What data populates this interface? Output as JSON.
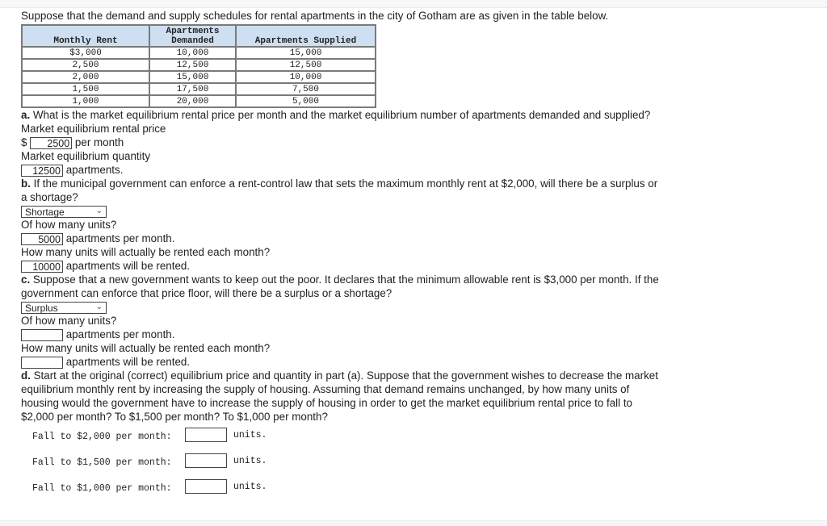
{
  "intro": "Suppose that the demand and supply schedules for rental apartments in the city of Gotham are as given in the table below.",
  "table": {
    "headers": [
      "Monthly Rent",
      "Apartments Demanded",
      "Apartments Supplied"
    ],
    "header_lines": {
      "demanded_1": "Apartments",
      "demanded_2": "Demanded"
    },
    "rows": [
      [
        "$3,000",
        "10,000",
        "15,000"
      ],
      [
        "2,500",
        "12,500",
        "12,500"
      ],
      [
        "2,000",
        "15,000",
        "10,000"
      ],
      [
        "1,500",
        "17,500",
        "7,500"
      ],
      [
        "1,000",
        "20,000",
        "5,000"
      ]
    ]
  },
  "part_a": {
    "label": "a.",
    "question": " What is the market equilibrium rental price per month and the market equilibrium number of apartments demanded and supplied?",
    "price_label": "Market equilibrium rental price",
    "currency": "$",
    "price_value": "2500",
    "price_suffix": "per month",
    "qty_label": "Market equilibrium quantity",
    "qty_value": "12500",
    "qty_suffix": "apartments."
  },
  "part_b": {
    "label": "b.",
    "question_1": " If the municipal government can enforce a rent-control law that sets the maximum monthly rent at $2,000, will there be a surplus or",
    "question_2": "a shortage?",
    "select_value": "Shortage",
    "units_q": "Of how many units?",
    "units_value": "5000",
    "units_suffix": "apartments per month.",
    "rented_q": "How many units will actually be rented each month?",
    "rented_value": "10000",
    "rented_suffix": "apartments will be rented."
  },
  "part_c": {
    "label": "c.",
    "question_1": " Suppose that a new government wants to keep out the poor. It declares that the minimum allowable rent is $3,000 per month. If the",
    "question_2": "government can enforce that price floor, will there be a surplus or a shortage?",
    "select_value": "Surplus",
    "units_q": "Of how many units?",
    "units_value": "",
    "units_suffix": "apartments per month.",
    "rented_q": "How many units will actually be rented each month?",
    "rented_value": "",
    "rented_suffix": "apartments will be rented."
  },
  "part_d": {
    "label": "d.",
    "question_1": " Start at the original (correct) equilibrium price and quantity in part (a). Suppose that the government wishes to decrease the market",
    "question_2": "equilibrium monthly rent by increasing the supply of housing. Assuming that demand remains unchanged, by how many units of",
    "question_3": "housing would the government have to increase the supply of housing in order to get the market equilibrium rental price to fall to",
    "question_4": "$2,000 per month? To $1,500 per month? To $1,000 per month?",
    "rows": [
      {
        "label": "Fall to $2,000 per month:",
        "value": "",
        "unit": "units."
      },
      {
        "label": "Fall to $1,500 per month:",
        "value": "",
        "unit": "units."
      },
      {
        "label": "Fall to $1,000 per month:",
        "value": "",
        "unit": "units."
      }
    ]
  }
}
